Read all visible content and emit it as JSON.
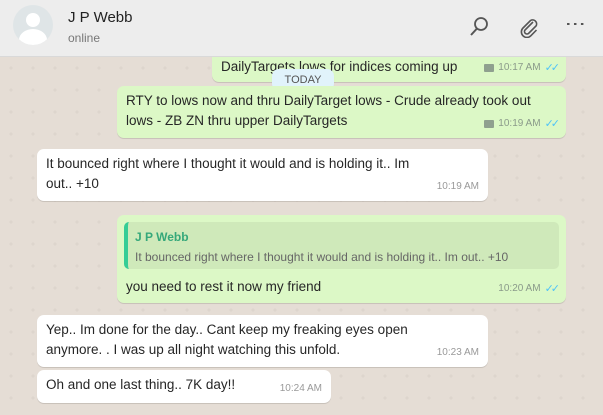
{
  "header": {
    "contact_name": "J P Webb",
    "status": "online",
    "icons": [
      "search-icon",
      "paperclip-icon",
      "menu-icon"
    ],
    "menu_glyph": "⋮"
  },
  "chat": {
    "date_divider": "TODAY",
    "messages": [
      {
        "direction": "out",
        "text": "DailyTargets lows for indices coming up",
        "time": "10:17 AM",
        "status": "read"
      },
      {
        "direction": "out",
        "text": "RTY to lows now and thru DailyTarget lows - Crude already took out lows - ZB ZN thru upper DailyTargets",
        "time": "10:19 AM",
        "status": "read"
      },
      {
        "direction": "in",
        "text": "It bounced right where I thought it would and is holding it..  Im out.. +10",
        "time": "10:19 AM"
      },
      {
        "direction": "out",
        "quoted_name": "J P Webb",
        "quoted_text": "It bounced right where I thought it would and is holding it.. Im out.. +10",
        "text": "you need to rest it now my friend",
        "time": "10:20 AM",
        "status": "read"
      },
      {
        "direction": "in",
        "text": "Yep.. Im done for the day..  Cant keep my freaking eyes open anymore. . I was up all night watching this unfold.",
        "time": "10:23 AM"
      },
      {
        "direction": "in",
        "text": "Oh and one last thing..  7K day!!",
        "time": "10:24 AM"
      }
    ],
    "read_ticks": "✓✓"
  },
  "colors": {
    "outgoing": "#dcf8c6",
    "incoming": "#ffffff",
    "read_ticks": "#4fc3f7",
    "quote_bar": "#35cd96"
  }
}
